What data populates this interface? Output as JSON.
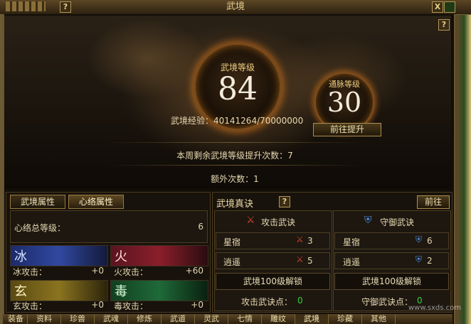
{
  "window": {
    "title": "武境",
    "help": "?",
    "close": "X"
  },
  "hero": {
    "level_label": "武境等级",
    "level": "84",
    "meridian_label": "通脉等级",
    "meridian_level": "30",
    "exp_text": "武境经验：40141264/70000000",
    "goto_upgrade": "前往提升",
    "weekly_remaining": "本周剩余武境等级提升次数：7",
    "extra_times": "额外次数：1"
  },
  "left_panel": {
    "tabs": [
      "武境属性",
      "心络属性"
    ],
    "total_level_label": "心络总等级：",
    "total_level_value": "6",
    "elements": [
      {
        "glyph": "冰",
        "stat": "冰攻击：",
        "value": "+0",
        "color": "#3048a0"
      },
      {
        "glyph": "火",
        "stat": "火攻击：",
        "value": "+60",
        "color": "#8b1e2b"
      },
      {
        "glyph": "玄",
        "stat": "玄攻击：",
        "value": "+0",
        "color": "#8a7420"
      },
      {
        "glyph": "毒",
        "stat": "毒攻击：",
        "value": "+0",
        "color": "#1f6a38"
      }
    ]
  },
  "right_panel": {
    "title": "武境真诀",
    "help": "?",
    "goto": "前往",
    "attack": {
      "header": "攻击武诀",
      "rows": [
        {
          "name": "星宿",
          "value": "3"
        },
        {
          "name": "逍遥",
          "value": "5"
        }
      ],
      "unlock": "武境100级解锁",
      "points_label": "攻击武诀点：",
      "points_value": "0"
    },
    "defense": {
      "header": "守御武诀",
      "rows": [
        {
          "name": "星宿",
          "value": "6"
        },
        {
          "name": "逍遥",
          "value": "2"
        }
      ],
      "unlock": "武境100级解锁",
      "points_label": "守御武诀点：",
      "points_value": "0"
    }
  },
  "bottom_tabs": [
    "装备",
    "资料",
    "珍兽",
    "武魂",
    "修炼",
    "武道",
    "灵武",
    "七情",
    "雕纹",
    "武境",
    "珍藏",
    "其他"
  ],
  "watermark": "www.sxds.com"
}
